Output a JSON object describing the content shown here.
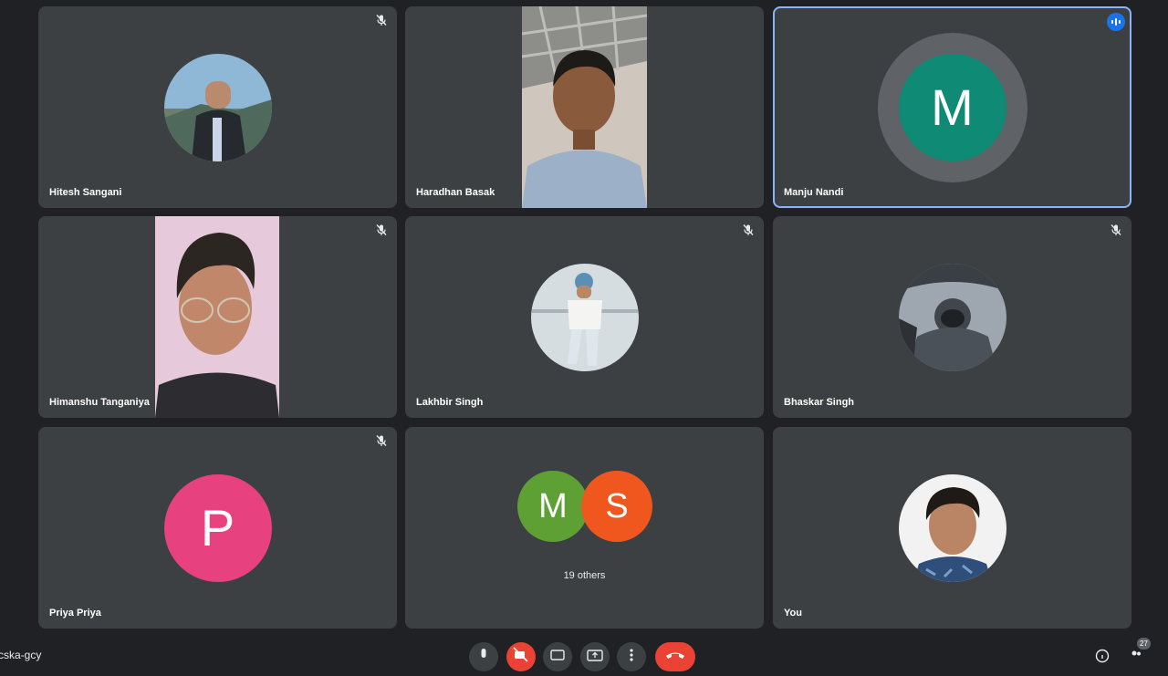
{
  "participants": [
    {
      "name": "Hitesh Sangani"
    },
    {
      "name": "Haradhan Basak"
    },
    {
      "name": "Manju Nandi",
      "initial": "M"
    },
    {
      "name": "Himanshu Tanganiya"
    },
    {
      "name": "Lakhbir Singh"
    },
    {
      "name": "Bhaskar Singh"
    },
    {
      "name": "Priya Priya",
      "initial": "P"
    },
    {
      "name": "You"
    }
  ],
  "others": {
    "initials": [
      "M",
      "S"
    ],
    "label": "19 others"
  },
  "bottom_bar": {
    "meeting_code": "cska-gcy",
    "participant_count": "27"
  },
  "colors": {
    "background": "#202124",
    "tile": "#3c4043",
    "speaking_border": "#8ab4f8",
    "avatar_m_teal": "#0f8a74",
    "avatar_p_pink": "#e8417f",
    "others_m_green": "#5fa034",
    "others_s_orange": "#f0571f",
    "leave_red": "#ea4335"
  },
  "icons": [
    "mic-off-icon",
    "speaking-indicator-icon",
    "mic-icon",
    "camera-off-icon",
    "captions-icon",
    "present-icon",
    "more-options-icon",
    "end-call-icon",
    "info-icon",
    "people-icon"
  ]
}
